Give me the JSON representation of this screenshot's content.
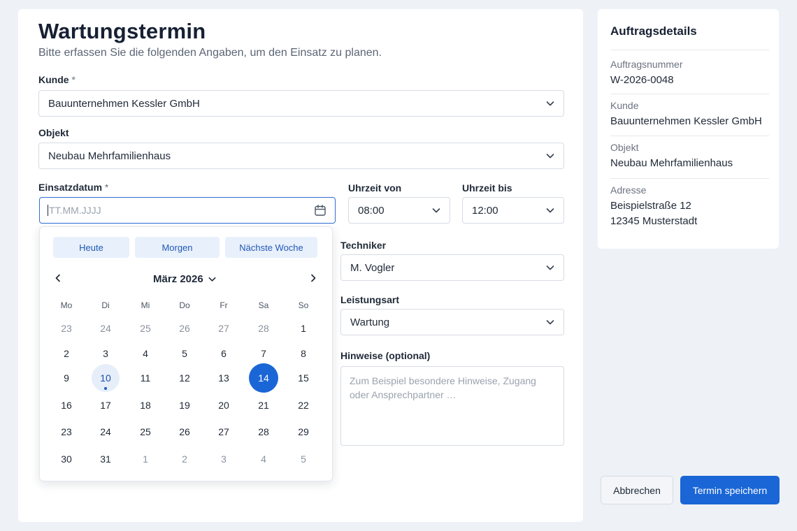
{
  "form": {
    "title": "Wartungstermin",
    "subtitle": "Bitte erfassen Sie die folgenden Angaben, um den Einsatz zu planen.",
    "kunde_label": "Kunde",
    "kunde_value": "Bauunternehmen Kessler GmbH",
    "objekt_label": "Objekt",
    "objekt_value": "Neubau Mehrfamilienhaus",
    "datum_label": "Einsatzdatum",
    "datum_placeholder": "TT.MM.JJJJ",
    "required_mark": "*",
    "von_label": "Uhrzeit von",
    "von_value": "08:00",
    "bis_label": "Uhrzeit bis",
    "bis_value": "12:00",
    "techniker_label": "Techniker",
    "techniker_value": "M. Vogler",
    "leistung_label": "Leistungsart",
    "leistung_value": "Wartung",
    "hinweise_label": "Hinweise (optional)",
    "hinweise_placeholder": "Zum Beispiel besondere Hinweise, Zugang oder Ansprechpartner …"
  },
  "calendar": {
    "quick": [
      "Heute",
      "Morgen",
      "Nächste Woche"
    ],
    "month_label": "März 2026",
    "weekdays": [
      "Mo",
      "Di",
      "Mi",
      "Do",
      "Fr",
      "Sa",
      "So"
    ],
    "weeks": [
      [
        "23",
        "24",
        "25",
        "26",
        "27",
        "28",
        "1"
      ],
      [
        "2",
        "3",
        "4",
        "5",
        "6",
        "7",
        "8"
      ],
      [
        "9",
        "10",
        "11",
        "12",
        "13",
        "14",
        "15"
      ],
      [
        "16",
        "17",
        "18",
        "19",
        "20",
        "21",
        "22"
      ],
      [
        "23",
        "24",
        "25",
        "26",
        "27",
        "28",
        "29"
      ],
      [
        "30",
        "31",
        "1",
        "2",
        "3",
        "4",
        "5"
      ]
    ],
    "today": "10",
    "selected": "14"
  },
  "details": {
    "title": "Auftragsdetails",
    "auftrag_key": "Auftragsnummer",
    "auftrag_val": "W-2026-0048",
    "kunde_key": "Kunde",
    "kunde_val": "Bauunternehmen Kessler GmbH",
    "objekt_key": "Objekt",
    "objekt_val": "Neubau Mehrfamilienhaus",
    "adresse_key": "Adresse",
    "adresse_line1": "Beispielstraße 12",
    "adresse_line2": "12345 Musterstadt"
  },
  "actions": {
    "cancel": "Abbrechen",
    "save": "Termin speichern"
  },
  "colors": {
    "primary": "#1a66d6",
    "background": "#eef2f7"
  }
}
